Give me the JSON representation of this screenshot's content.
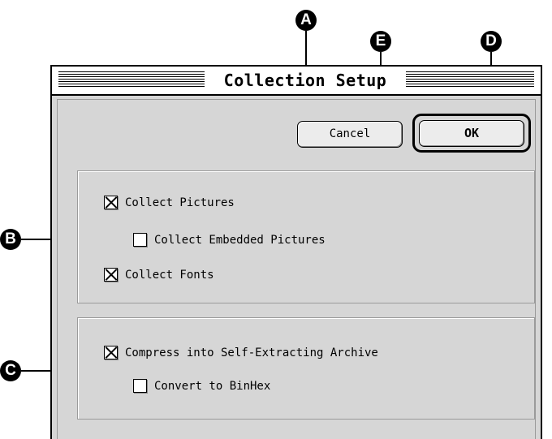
{
  "window": {
    "title": "Collection Setup"
  },
  "buttons": {
    "cancel": "Cancel",
    "ok": "OK"
  },
  "group_collect": {
    "collect_pictures": {
      "label": "Collect Pictures",
      "checked": true
    },
    "collect_embedded_pictures": {
      "label": "Collect Embedded Pictures",
      "checked": false
    },
    "collect_fonts": {
      "label": "Collect Fonts",
      "checked": true
    }
  },
  "group_compress": {
    "compress_archive": {
      "label": "Compress into Self-Extracting Archive",
      "checked": true
    },
    "convert_binhex": {
      "label": "Convert to BinHex",
      "checked": false
    }
  },
  "callouts": {
    "a": "A",
    "b": "B",
    "c": "C",
    "d": "D",
    "e": "E"
  }
}
